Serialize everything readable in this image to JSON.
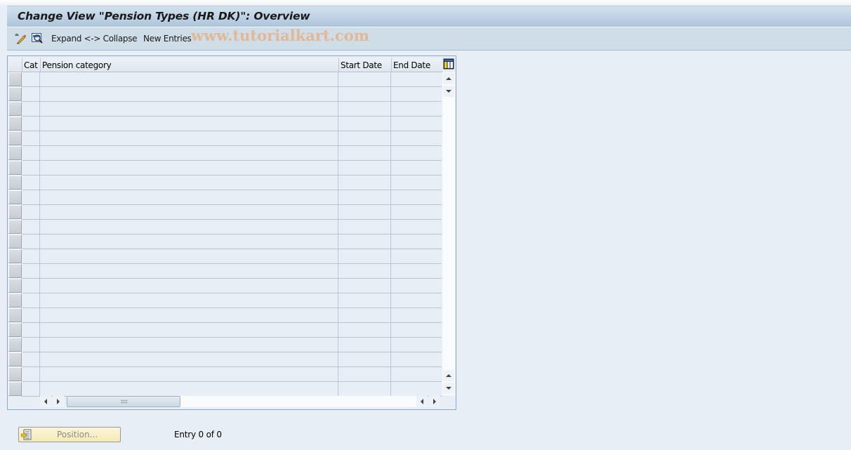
{
  "title": "Change View \"Pension Types (HR DK)\": Overview",
  "toolbar": {
    "icons": [
      "display-change-icon",
      "select-all-icon"
    ],
    "expand_collapse_label": "Expand <-> Collapse",
    "new_entries_label": "New Entries"
  },
  "watermark": "www.tutorialkart.com",
  "table": {
    "columns": [
      {
        "key": "cat",
        "label": "Cat"
      },
      {
        "key": "pension_category",
        "label": "Pension category"
      },
      {
        "key": "start_date",
        "label": "Start Date"
      },
      {
        "key": "end_date",
        "label": "End Date"
      }
    ],
    "visible_empty_rows": 22,
    "rows": []
  },
  "footer": {
    "position_button_label": "Position...",
    "entry_status": "Entry 0 of 0"
  }
}
